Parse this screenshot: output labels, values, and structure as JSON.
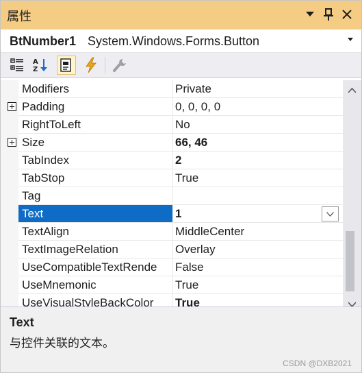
{
  "window": {
    "title": "属性",
    "buttons": [
      {
        "name": "dropdown-icon",
        "symbol": "▾"
      },
      {
        "name": "pin-icon",
        "symbol": "pin"
      },
      {
        "name": "close-icon",
        "symbol": "✕"
      }
    ]
  },
  "object_selector": {
    "name": "BtNumber1",
    "type": "System.Windows.Forms.Button"
  },
  "toolbar": {
    "tools": [
      {
        "name": "categorized-icon",
        "active": false
      },
      {
        "name": "alphabetical-icon",
        "active": false
      },
      {
        "name": "properties-icon",
        "active": true
      },
      {
        "name": "events-icon",
        "active": false
      },
      {
        "name": "property-pages-icon",
        "active": false
      }
    ]
  },
  "properties": [
    {
      "name": "Modifiers",
      "value": "Private",
      "bold": false,
      "expandable": false
    },
    {
      "name": "Padding",
      "value": "0, 0, 0, 0",
      "bold": false,
      "expandable": true
    },
    {
      "name": "RightToLeft",
      "value": "No",
      "bold": false,
      "expandable": false
    },
    {
      "name": "Size",
      "value": "66, 46",
      "bold": true,
      "expandable": true
    },
    {
      "name": "TabIndex",
      "value": "2",
      "bold": true,
      "expandable": false
    },
    {
      "name": "TabStop",
      "value": "True",
      "bold": false,
      "expandable": false
    },
    {
      "name": "Tag",
      "value": "",
      "bold": false,
      "expandable": false
    },
    {
      "name": "Text",
      "value": "1",
      "bold": true,
      "expandable": false,
      "selected": true
    },
    {
      "name": "TextAlign",
      "value": "MiddleCenter",
      "bold": false,
      "expandable": false
    },
    {
      "name": "TextImageRelation",
      "value": "Overlay",
      "bold": false,
      "expandable": false
    },
    {
      "name": "UseCompatibleTextRende",
      "value": "False",
      "bold": false,
      "expandable": false
    },
    {
      "name": "UseMnemonic",
      "value": "True",
      "bold": false,
      "expandable": false
    },
    {
      "name": "UseVisualStyleBackColor",
      "value": "True",
      "bold": true,
      "expandable": false
    }
  ],
  "description": {
    "title": "Text",
    "text": "与控件关联的文本。"
  },
  "watermark": "CSDN @DXB2021",
  "colors": {
    "title_bar": "#f5cc84",
    "selection": "#0f6cc6",
    "toolbar": "#eeeef2",
    "description_bg": "#f0f0f0"
  }
}
